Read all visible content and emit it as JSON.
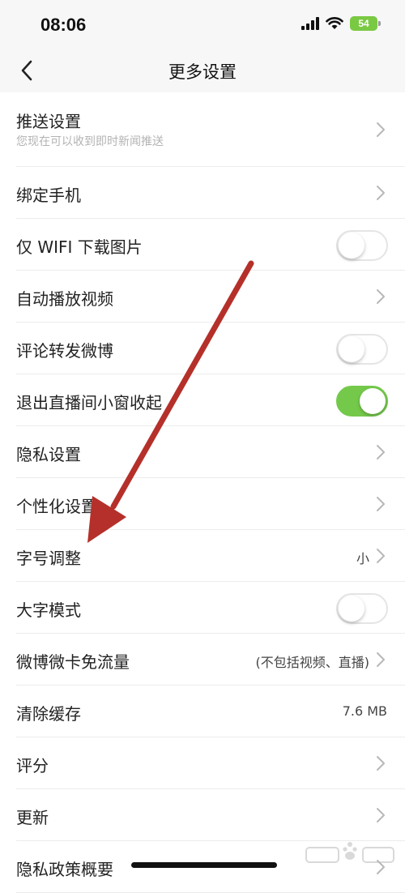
{
  "status_bar": {
    "time": "08:06",
    "battery": "54"
  },
  "nav": {
    "title": "更多设置"
  },
  "settings": [
    {
      "label": "推送设置",
      "subtitle": "您现在可以收到即时新闻推送",
      "type": "chevron"
    },
    {
      "label": "绑定手机",
      "type": "chevron"
    },
    {
      "label": "仅 WIFI 下载图片",
      "type": "toggle",
      "on": false
    },
    {
      "label": "自动播放视频",
      "type": "chevron"
    },
    {
      "label": "评论转发微博",
      "type": "toggle",
      "on": false
    },
    {
      "label": "退出直播间小窗收起",
      "type": "toggle",
      "on": true
    },
    {
      "label": "隐私设置",
      "type": "chevron"
    },
    {
      "label": "个性化设置",
      "type": "chevron"
    },
    {
      "label": "字号调整",
      "value": "小",
      "type": "chevron"
    },
    {
      "label": "大字模式",
      "type": "toggle",
      "on": false
    },
    {
      "label": "微博微卡免流量",
      "value": "(不包括视频、直播)",
      "type": "chevron"
    },
    {
      "label": "清除缓存",
      "value": "7.6 MB",
      "type": "value"
    },
    {
      "label": "评分",
      "type": "chevron"
    },
    {
      "label": "更新",
      "type": "chevron"
    },
    {
      "label": "隐私政策概要",
      "type": "chevron"
    }
  ],
  "colors": {
    "toggle_on": "#74c94b",
    "arrow": "#b5302a",
    "battery": "#7ac943"
  },
  "icons": {
    "back": "chevron-left-icon",
    "row_chevron": "chevron-right-icon",
    "signal": "signal-bars-icon",
    "wifi": "wifi-icon",
    "battery": "battery-icon"
  }
}
